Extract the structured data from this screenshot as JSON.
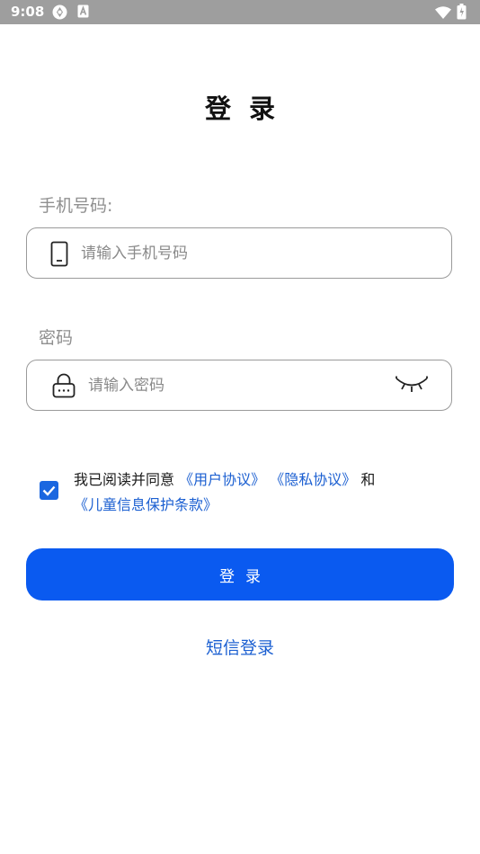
{
  "status_bar": {
    "time": "9:08",
    "icons": [
      "sync-icon",
      "a-badge-icon",
      "wifi-icon",
      "battery-icon"
    ],
    "color": "#9e9e9e"
  },
  "title": "登录",
  "phone": {
    "label": "手机号码:",
    "placeholder": "请输入手机号码",
    "value": "",
    "icon": "phone-icon"
  },
  "password": {
    "label": "密码",
    "placeholder": "请输入密码",
    "value": "",
    "icon": "lock-icon",
    "toggle_icon": "eye-closed-icon"
  },
  "agreement": {
    "checked": true,
    "prefix": "我已阅读并同意",
    "user_agreement": "《用户协议》",
    "privacy_policy": "《隐私协议》",
    "conjunction": "和",
    "children_terms": "《儿童信息保护条款》"
  },
  "login_button": "登录",
  "sms_login": "短信登录",
  "colors": {
    "primary": "#0a5af0",
    "link": "#1b5fd1",
    "label": "#8f8f8f"
  }
}
